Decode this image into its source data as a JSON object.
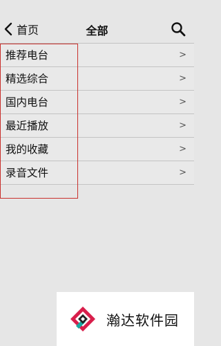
{
  "header": {
    "back_label": "首页",
    "title": "全部"
  },
  "list": {
    "items": [
      {
        "label": "推荐电台",
        "chevron": ">"
      },
      {
        "label": "精选综合",
        "chevron": ">"
      },
      {
        "label": "国内电台",
        "chevron": ">"
      },
      {
        "label": "最近播放",
        "chevron": ">"
      },
      {
        "label": "我的收藏",
        "chevron": ">"
      },
      {
        "label": "录音文件",
        "chevron": ">"
      }
    ]
  },
  "annotation": {
    "box_color": "#c9302c"
  },
  "watermark": {
    "text": "瀚达软件园",
    "logo_colors": [
      "#d81e4b",
      "#17a9a1",
      "#222222"
    ]
  }
}
